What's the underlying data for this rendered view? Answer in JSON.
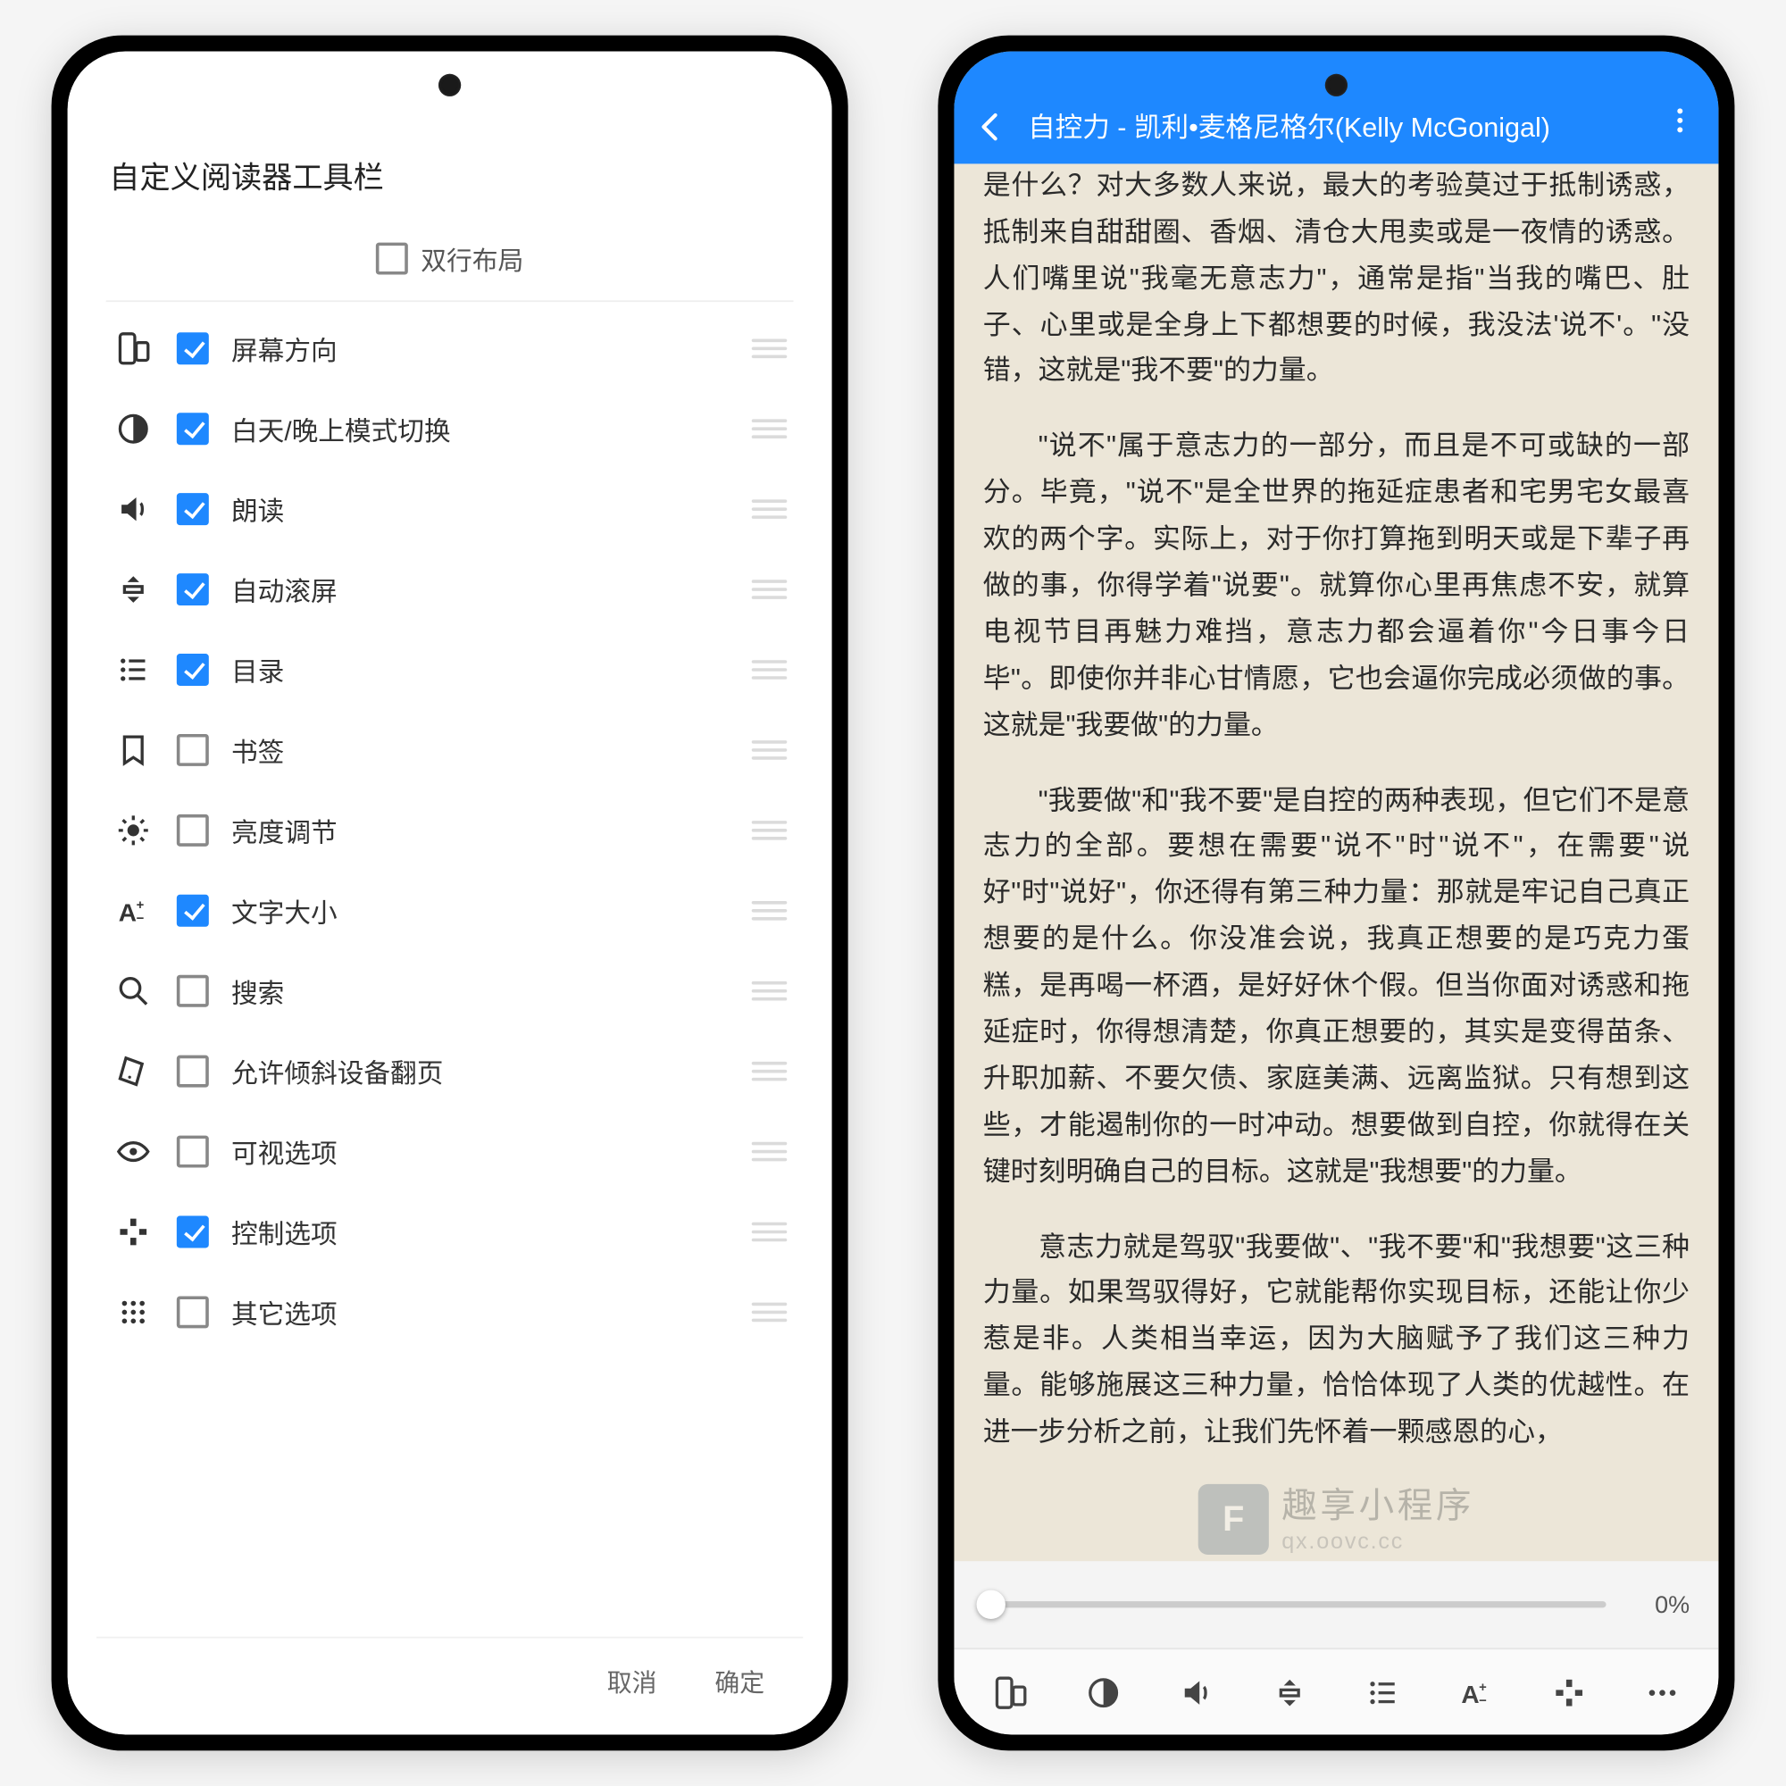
{
  "watermark": {
    "logo": "F",
    "line1": "趣享小程序",
    "line2": "qx.oovc.cc"
  },
  "leftPhone": {
    "title": "自定义阅读器工具栏",
    "dualRow": {
      "label": "双行布局",
      "checked": false
    },
    "items": [
      {
        "icon": "rotate",
        "label": "屏幕方向",
        "checked": true
      },
      {
        "icon": "daynight",
        "label": "白天/晚上模式切换",
        "checked": true
      },
      {
        "icon": "speak",
        "label": "朗读",
        "checked": true
      },
      {
        "icon": "autoscroll",
        "label": "自动滚屏",
        "checked": true
      },
      {
        "icon": "toc",
        "label": "目录",
        "checked": true
      },
      {
        "icon": "bookmark",
        "label": "书签",
        "checked": false
      },
      {
        "icon": "brightness",
        "label": "亮度调节",
        "checked": false
      },
      {
        "icon": "fontsize",
        "label": "文字大小",
        "checked": true
      },
      {
        "icon": "search",
        "label": "搜索",
        "checked": false
      },
      {
        "icon": "tilt",
        "label": "允许倾斜设备翻页",
        "checked": false
      },
      {
        "icon": "visual",
        "label": "可视选项",
        "checked": false
      },
      {
        "icon": "control",
        "label": "控制选项",
        "checked": true
      },
      {
        "icon": "other",
        "label": "其它选项",
        "checked": false
      }
    ],
    "cancel": "取消",
    "ok": "确定"
  },
  "rightPhone": {
    "title": "自控力 - 凯利•麦格尼格尔(Kelly McGonigal)",
    "progress": "0%",
    "paragraphs": [
      "如果我问你说出一件最需要意志力的事，你第一个想到的是什么？对大多数人来说，最大的考验莫过于抵制诱惑，抵制来自甜甜圈、香烟、清仓大甩卖或是一夜情的诱惑。人们嘴里说\"我毫无意志力\"，通常是指\"当我的嘴巴、肚子、心里或是全身上下都想要的时候，我没法'说不'。\"没错，这就是\"我不要\"的力量。",
      "\"说不\"属于意志力的一部分，而且是不可或缺的一部分。毕竟，\"说不\"是全世界的拖延症患者和宅男宅女最喜欢的两个字。实际上，对于你打算拖到明天或是下辈子再做的事，你得学着\"说要\"。就算你心里再焦虑不安，就算电视节目再魅力难挡，意志力都会逼着你\"今日事今日毕\"。即使你并非心甘情愿，它也会逼你完成必须做的事。这就是\"我要做\"的力量。",
      "\"我要做\"和\"我不要\"是自控的两种表现，但它们不是意志力的全部。要想在需要\"说不\"时\"说不\"，在需要\"说好\"时\"说好\"，你还得有第三种力量：那就是牢记自己真正想要的是什么。你没准会说，我真正想要的是巧克力蛋糕，是再喝一杯酒，是好好休个假。但当你面对诱惑和拖延症时，你得想清楚，你真正想要的，其实是变得苗条、升职加薪、不要欠债、家庭美满、远离监狱。只有想到这些，才能遏制你的一时冲动。想要做到自控，你就得在关键时刻明确自己的目标。这就是\"我想要\"的力量。",
      "意志力就是驾驭\"我要做\"、\"我不要\"和\"我想要\"这三种力量。如果驾驭得好，它就能帮你实现目标，还能让你少惹是非。人类相当幸运，因为大脑赋予了我们这三种力量。能够施展这三种力量，恰恰体现了人类的优越性。在进一步分析之前，让我们先怀着一颗感恩的心，"
    ],
    "toolbarIcons": [
      "rotate",
      "daynight",
      "speak",
      "autoscroll",
      "toc",
      "fontsize",
      "control",
      "more"
    ]
  }
}
